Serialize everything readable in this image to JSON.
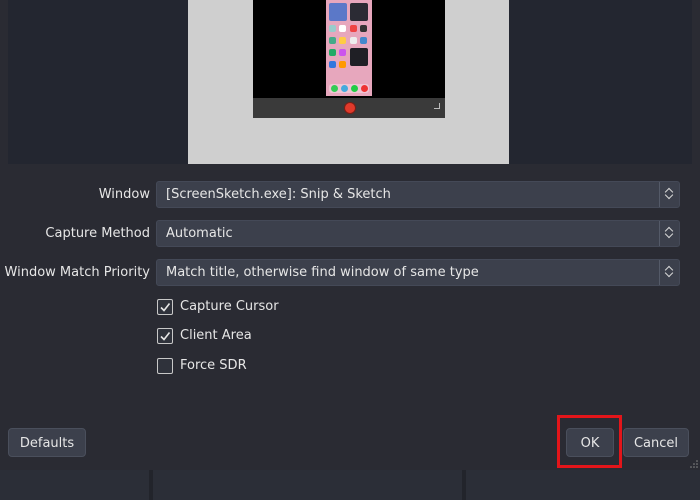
{
  "preview": {
    "background_color": "#cfcfcf",
    "captured_window_color": "#000000",
    "record_button_color": "#e03a2b"
  },
  "form": {
    "window": {
      "label": "Window",
      "value": "[ScreenSketch.exe]: Snip & Sketch"
    },
    "capture_method": {
      "label": "Capture Method",
      "value": "Automatic"
    },
    "window_match_priority": {
      "label": "Window Match Priority",
      "value": "Match title, otherwise find window of same type"
    },
    "checkboxes": [
      {
        "label": "Capture Cursor",
        "checked": true
      },
      {
        "label": "Client Area",
        "checked": true
      },
      {
        "label": "Force SDR",
        "checked": false
      }
    ]
  },
  "buttons": {
    "defaults": "Defaults",
    "ok": "OK",
    "cancel": "Cancel"
  },
  "colors": {
    "dialog_background": "#2a2b33",
    "control_background": "#3c404c",
    "highlight_border": "#e3151a"
  }
}
